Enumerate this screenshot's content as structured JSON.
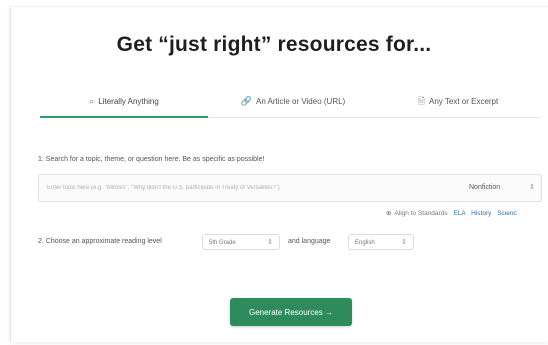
{
  "headline": "Get “just right” resources for...",
  "tabs": [
    {
      "icon": "⌕",
      "label": "Literally Anything",
      "active": true
    },
    {
      "icon": "🔗",
      "label": "An Article or Video (URL)",
      "active": false
    },
    {
      "icon": "🗎",
      "label": "Any Text or Excerpt",
      "active": false
    }
  ],
  "step1": {
    "label": "1. Search for a topic, theme, or question here. Be as specific as possible!",
    "placeholder": "Enter topic here (e.g. \"Mitosis\", \"Why didn't the U.S. participate in Treaty of Versailles?\")",
    "type_value": "Nonfiction",
    "type_arrow": "⇕"
  },
  "standards": {
    "icon": "⊕",
    "label": "Align to Standards",
    "links": [
      "ELA",
      "History",
      "Scienc"
    ]
  },
  "step2": {
    "label": "2. Choose an approximate reading level",
    "grade_value": "5th Grade",
    "language_label": "and language",
    "language_value": "English",
    "arrow": "⇕"
  },
  "generate_button": "Generate Resources →",
  "colors": {
    "accent": "#2e8c5c",
    "tab_active_underline": "#2e9e6a",
    "link": "#2b6cb0"
  }
}
